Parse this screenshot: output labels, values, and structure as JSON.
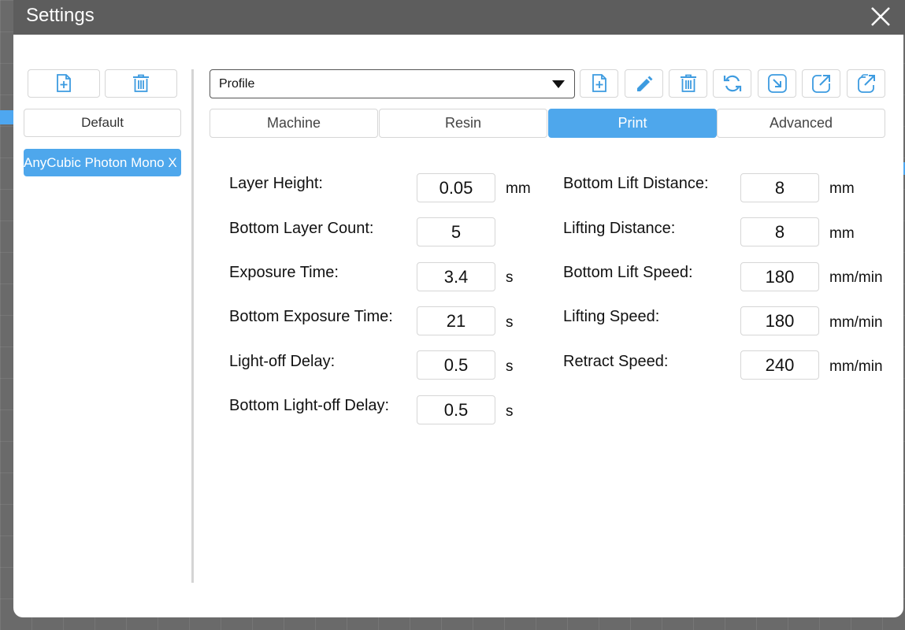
{
  "window": {
    "title": "Settings"
  },
  "colors": {
    "accent": "#4ea7ec",
    "icon": "#3d9be0",
    "titlebar": "#5d5d5d"
  },
  "left_panel": {
    "add_icon": "file-plus-icon",
    "delete_icon": "trash-icon",
    "default_label": "Default",
    "machines": [
      "AnyCubic Photon Mono X"
    ]
  },
  "toolbar": {
    "profile_value": "Profile",
    "icons": [
      "file-plus-icon",
      "pencil-icon",
      "trash-icon",
      "refresh-icon",
      "import-icon",
      "export-icon",
      "export-all-icon"
    ]
  },
  "tabs": [
    {
      "label": "Machine",
      "active": false
    },
    {
      "label": "Resin",
      "active": false
    },
    {
      "label": "Print",
      "active": true
    },
    {
      "label": "Advanced",
      "active": false
    }
  ],
  "print_settings": {
    "left": [
      {
        "label": "Layer Height:",
        "value": "0.05",
        "unit": "mm"
      },
      {
        "label": "Bottom Layer Count:",
        "value": "5",
        "unit": ""
      },
      {
        "label": "Exposure Time:",
        "value": "3.4",
        "unit": "s"
      },
      {
        "label": "Bottom Exposure Time:",
        "value": "21",
        "unit": "s"
      },
      {
        "label": "Light-off Delay:",
        "value": "0.5",
        "unit": "s"
      },
      {
        "label": "Bottom Light-off Delay:",
        "value": "0.5",
        "unit": "s"
      }
    ],
    "right": [
      {
        "label": "Bottom Lift Distance:",
        "value": "8",
        "unit": "mm"
      },
      {
        "label": "Lifting Distance:",
        "value": "8",
        "unit": "mm"
      },
      {
        "label": "Bottom Lift Speed:",
        "value": "180",
        "unit": "mm/min"
      },
      {
        "label": "Lifting Speed:",
        "value": "180",
        "unit": "mm/min"
      },
      {
        "label": "Retract Speed:",
        "value": "240",
        "unit": "mm/min"
      }
    ]
  }
}
